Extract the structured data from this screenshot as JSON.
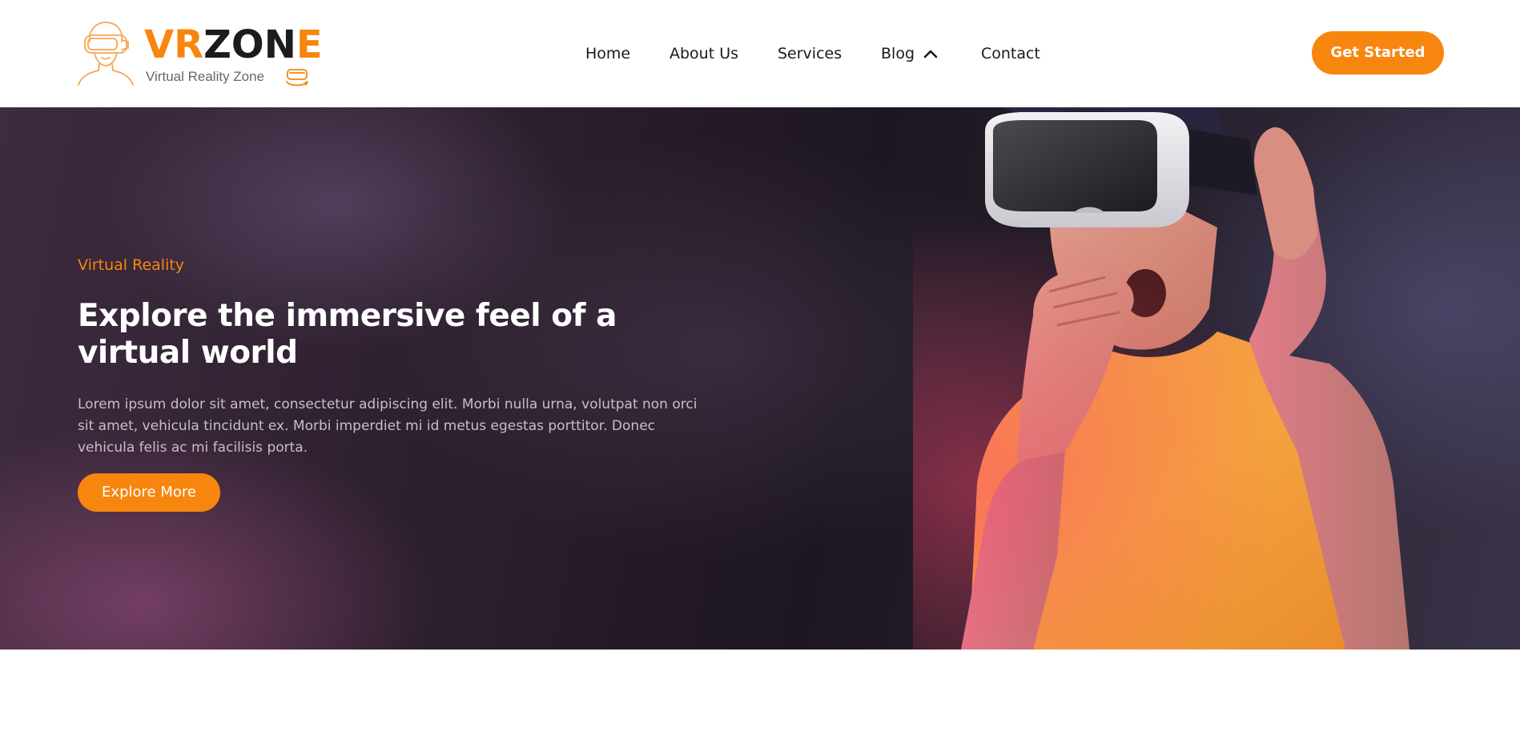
{
  "header": {
    "logo": {
      "word_part1": "VR",
      "word_part2": "ZON",
      "word_part3": "E",
      "tagline": "Virtual Reality Zone",
      "icon": "vr-headset-person-icon"
    },
    "nav": {
      "items": [
        {
          "label": "Home"
        },
        {
          "label": "About Us"
        },
        {
          "label": "Services"
        },
        {
          "label": "Blog",
          "icon": "chevron-up-icon"
        },
        {
          "label": "Contact"
        }
      ]
    },
    "cta_label": "Get Started"
  },
  "hero": {
    "eyebrow": "Virtual Reality",
    "title": "Explore the immersive feel of a virtual world",
    "description": "Lorem ipsum dolor sit amet, consectetur adipiscing elit. Morbi nulla urna, volutpat non orci sit amet, vehicula tincidunt ex. Morbi imperdiet mi id metus egestas porttitor. Donec vehicula felis ac mi facilisis porta.",
    "button_label": "Explore More",
    "image": "man-wearing-vr-headset-photo"
  },
  "colors": {
    "accent": "#f7860f",
    "dark_text": "#1c1c1c",
    "hero_bg": "#2a1e2b",
    "hero_text": "#ffffff"
  }
}
